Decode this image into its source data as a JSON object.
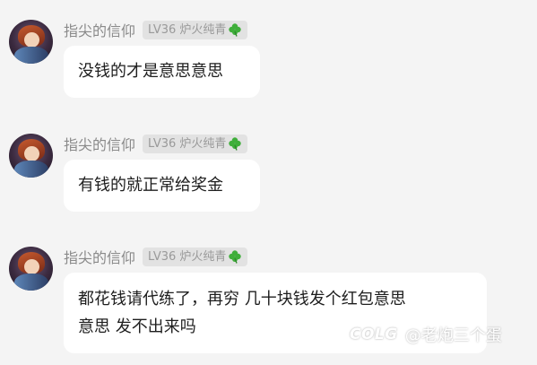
{
  "messages": [
    {
      "nickname": "指尖的信仰",
      "level_tag": "LV36 炉火纯青",
      "text": "没钱的才是意思意思"
    },
    {
      "nickname": "指尖的信仰",
      "level_tag": "LV36 炉火纯青",
      "text": "有钱的就正常给奖金"
    },
    {
      "nickname": "指尖的信仰",
      "level_tag": "LV36 炉火纯青",
      "text_line1": "都花钱请代练了，再穷 几十块钱发个红包意思",
      "text_line2": "意思 发不出来吗"
    }
  ],
  "watermark": {
    "logo": "COLG",
    "handle": "@老炮三个蛋"
  },
  "colors": {
    "background": "#f4f4f4",
    "bubble": "#ffffff",
    "tag_bg": "#e2e2e2",
    "nickname": "#8a8a8a",
    "clover": "#3fae3a"
  }
}
